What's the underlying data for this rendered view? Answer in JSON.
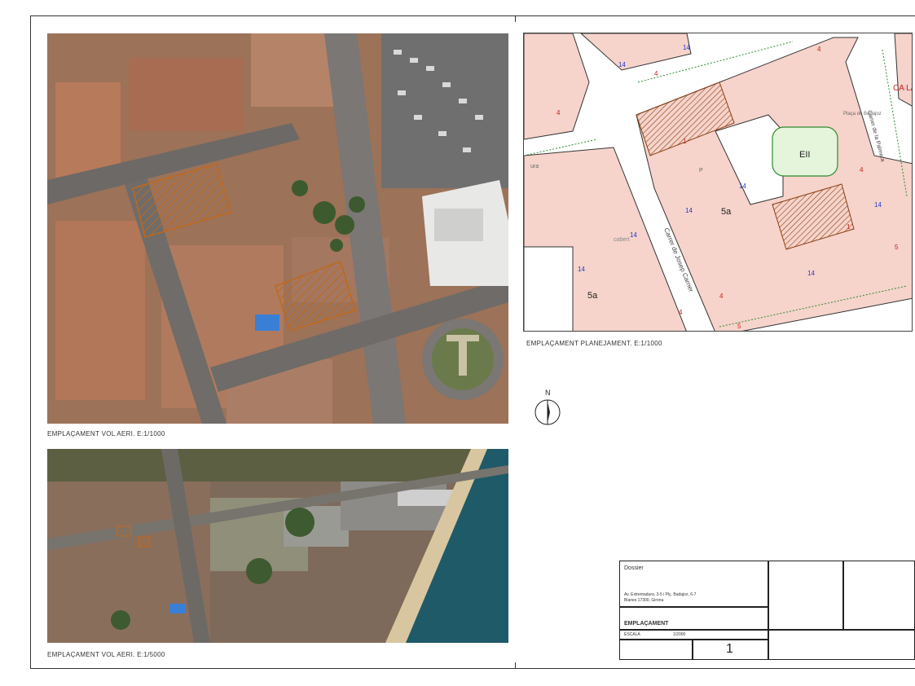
{
  "captions": {
    "aerial_1000": "EMPLAÇAMENT VOL AERI. E:1/1000",
    "aerial_5000": "EMPLAÇAMENT VOL AERI. E:1/5000",
    "planning_1000": "EMPLAÇAMENT PLANEJAMENT. E:1/1000"
  },
  "north_arrow": {
    "label": "N"
  },
  "plan_labels": {
    "street_1": "Carrer de Josep Carner",
    "street_2": "Carrer de la Palmera",
    "square": "Plaça de Badajoz",
    "zone_eii": "EII",
    "zone_5a_1": "5a",
    "zone_5a_2": "5a",
    "p_label": "P",
    "num_14": "14",
    "num_4": "4",
    "num_5": "5",
    "num_1": "1",
    "cobert": "cobert",
    "cut_red": "CA LA S (dis",
    "cut_left": "ura"
  },
  "title_block": {
    "dossier": "Dossier",
    "address_line1": "Av. Extremadura, 3-5 i Plç. Badajoz, 6-7",
    "address_line2": "Blanes 17300, Girona",
    "sheet_title": "EMPLAÇAMENT",
    "scale_label": "ESCALA",
    "scale_value": "1/2000",
    "sheet_number": "1"
  },
  "colors": {
    "plot_hatch": "#c0681c",
    "plan_block_fill": "#f6d3cb",
    "plan_green": "#2e8b2e",
    "plan_red_text": "#c81e1e",
    "plan_blue_text": "#1f3cc8",
    "sea": "#1f5a68"
  }
}
